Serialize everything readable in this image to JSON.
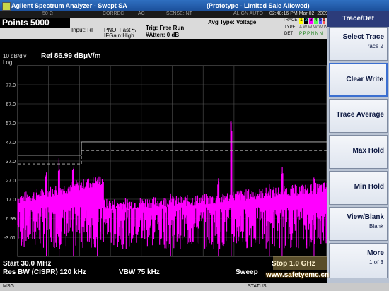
{
  "window": {
    "title": "Agilent Spectrum Analyzer - Swept SA",
    "center_title": "(Prototype - Limited Sale Allowed)"
  },
  "status_row": {
    "item1": "50 Ω",
    "item2": "CORREC",
    "item3": "AC",
    "item4": "SENSE:INT",
    "item5": "ALIGN AUTO",
    "datetime": "02:48:16 PM Mar 02, 2009"
  },
  "settings": {
    "points_label": "Points",
    "points_value": "5000",
    "input": "Input: RF",
    "pno": "PNO: Fast",
    "ifgain": "IFGain:High",
    "trig": "Trig: Free Run",
    "atten": "#Atten: 0 dB",
    "avg_type": "Avg Type: Voltage",
    "trace_label": "TRACE",
    "type_label": "TYPE",
    "det_label": "DET",
    "trace_nums": [
      "1",
      "2",
      "3",
      "4",
      "5",
      "6"
    ],
    "trace_types": "A W W W W W",
    "trace_dets": "P P P N N N"
  },
  "plot": {
    "scale": "10 dB/div",
    "scale_type": "Log",
    "ref": "Ref 86.99 dBμV/m",
    "trace_color": "#ff00ff"
  },
  "footer": {
    "start": "Start 30.0 MHz",
    "rbw": "Res BW (CISPR)  120 kHz",
    "vbw": "VBW 75 kHz",
    "sweep": "Sweep",
    "stop": "Stop 1.0 GHz",
    "msg": "MSG",
    "status": "STATUS"
  },
  "softkeys": {
    "title": "Trace/Det",
    "items": [
      {
        "label": "Select Trace",
        "sub": "Trace 2"
      },
      {
        "label": "Clear Write",
        "sub": ""
      },
      {
        "label": "Trace Average",
        "sub": ""
      },
      {
        "label": "Max Hold",
        "sub": ""
      },
      {
        "label": "Min Hold",
        "sub": ""
      },
      {
        "label": "View/Blank",
        "sub": "Blank"
      },
      {
        "label": "More",
        "sub": "1 of 3"
      }
    ]
  },
  "watermark": {
    "text": "www.safetyemc.cn"
  },
  "chart_data": {
    "type": "line",
    "title": "",
    "xlabel": "",
    "ylabel": "",
    "yticks": [
      "77.0",
      "67.0",
      "57.0",
      "47.0",
      "37.0",
      "27.0",
      "17.0",
      "6.99",
      "-3.01"
    ],
    "ylim": [
      -13.01,
      86.99
    ],
    "xlim_mhz": [
      30.0,
      1000.0
    ],
    "limit_lines": {
      "solid": [
        {
          "x_mhz": [
            30,
            230
          ],
          "y": 40
        },
        {
          "x_mhz": [
            230,
            1000
          ],
          "y": 47
        }
      ],
      "dashed": [
        {
          "x_mhz": [
            30,
            230
          ],
          "y": 35.5
        },
        {
          "x_mhz": [
            230,
            1000
          ],
          "y": 42.5
        }
      ]
    },
    "series": [
      {
        "name": "",
        "peaks": [
          {
            "x_mhz": 120,
            "y": 31
          },
          {
            "x_mhz": 160,
            "y": 36
          },
          {
            "x_mhz": 205,
            "y": 33
          },
          {
            "x_mhz": 280,
            "y": 27
          },
          {
            "x_mhz": 510,
            "y": 20
          },
          {
            "x_mhz": 660,
            "y": 28
          },
          {
            "x_mhz": 700,
            "y": 58
          },
          {
            "x_mhz": 820,
            "y": 23
          },
          {
            "x_mhz": 860,
            "y": 31
          },
          {
            "x_mhz": 960,
            "y": 26
          }
        ]
      }
    ]
  }
}
